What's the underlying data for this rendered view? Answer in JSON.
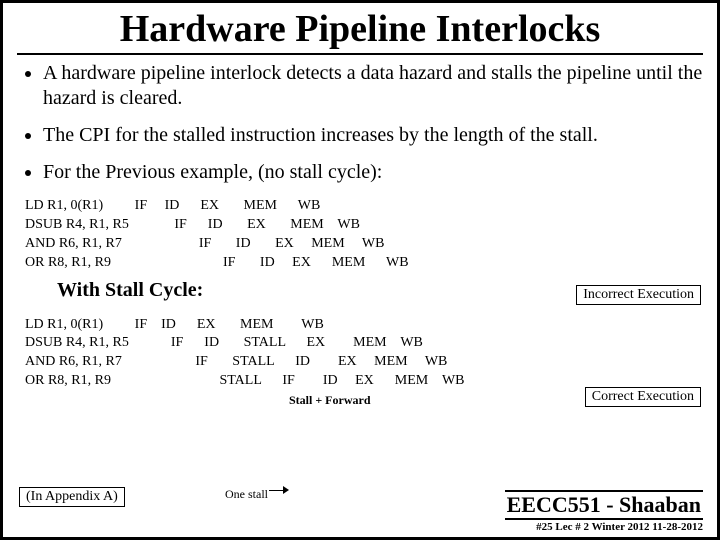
{
  "title": "Hardware Pipeline Interlocks",
  "bullets": [
    "A hardware pipeline interlock detects a data hazard and stalls the pipeline until the hazard is cleared.",
    "The CPI for the stalled instruction increases by the length of the stall.",
    "For the Previous example,  (no stall cycle):"
  ],
  "pipe1": "LD R1, 0(R1)         IF     ID      EX       MEM      WB\nDSUB R4, R1, R5             IF      ID       EX       MEM    WB\nAND R6, R1, R7                      IF       ID       EX     MEM     WB\nOR R8, R1, R9                                IF       ID     EX      MEM      WB",
  "sub_head": "With Stall Cycle:",
  "stall_lbl": "Stall + Forward",
  "pipe2": "LD R1, 0(R1)         IF    ID      EX       MEM        WB\nDSUB R4, R1, R5            IF      ID       STALL      EX        MEM    WB\nAND R6, R1, R7                     IF       STALL      ID        EX     MEM     WB\nOR R8, R1, R9                               STALL      IF        ID     EX      MEM    WB",
  "tags": {
    "incorrect": "Incorrect Execution",
    "correct": "Correct Execution",
    "appendix": "(In  Appendix A)"
  },
  "one_stall": "One stall",
  "footer": {
    "course": "EECC551 - Shaaban",
    "fine": "#25  Lec # 2   Winter 2012   11-28-2012"
  }
}
